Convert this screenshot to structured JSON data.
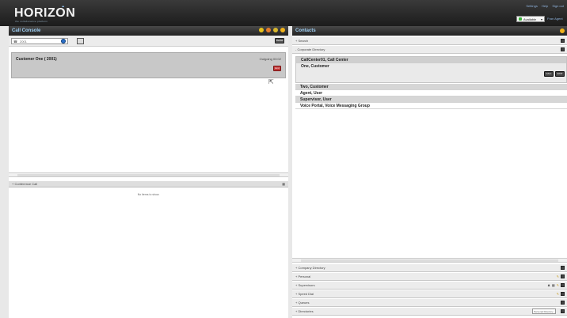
{
  "brand": {
    "name": "HORIZON",
    "tagline": "the collaborative platform",
    "accent": "#8ab6e0"
  },
  "top_links": [
    "Settings",
    "Help",
    "Sign out"
  ],
  "presence": {
    "status": "Available",
    "color": "#3bb13b",
    "user": "Fran Agent"
  },
  "call_console": {
    "title": "Call Console",
    "dial_value": "2001",
    "redial_label": "Redial",
    "call": {
      "name": "Customer One ( 2001)",
      "status": "Outgoing 00:02",
      "end_label": "End"
    },
    "conference": {
      "title": "Conference Call",
      "empty_text": "No items to show."
    }
  },
  "contacts": {
    "title": "Contacts",
    "sections_top": [
      "Search",
      "Corporate Directory"
    ],
    "group": {
      "title": "CallCenter01, Call Center",
      "item": "One, Customer",
      "call_label": "CALL",
      "edit_label": "EDIT"
    },
    "rows": [
      "Two, Customer",
      "Agent, User",
      "Supervisor, User",
      "Voice Portal, Voice Messaging Group"
    ],
    "sections_bottom": [
      "Company Directory",
      "Personal",
      "Supervisors",
      "Speed Dial",
      "Queues",
      "Directories"
    ],
    "directory_select": "Personal Directory"
  }
}
